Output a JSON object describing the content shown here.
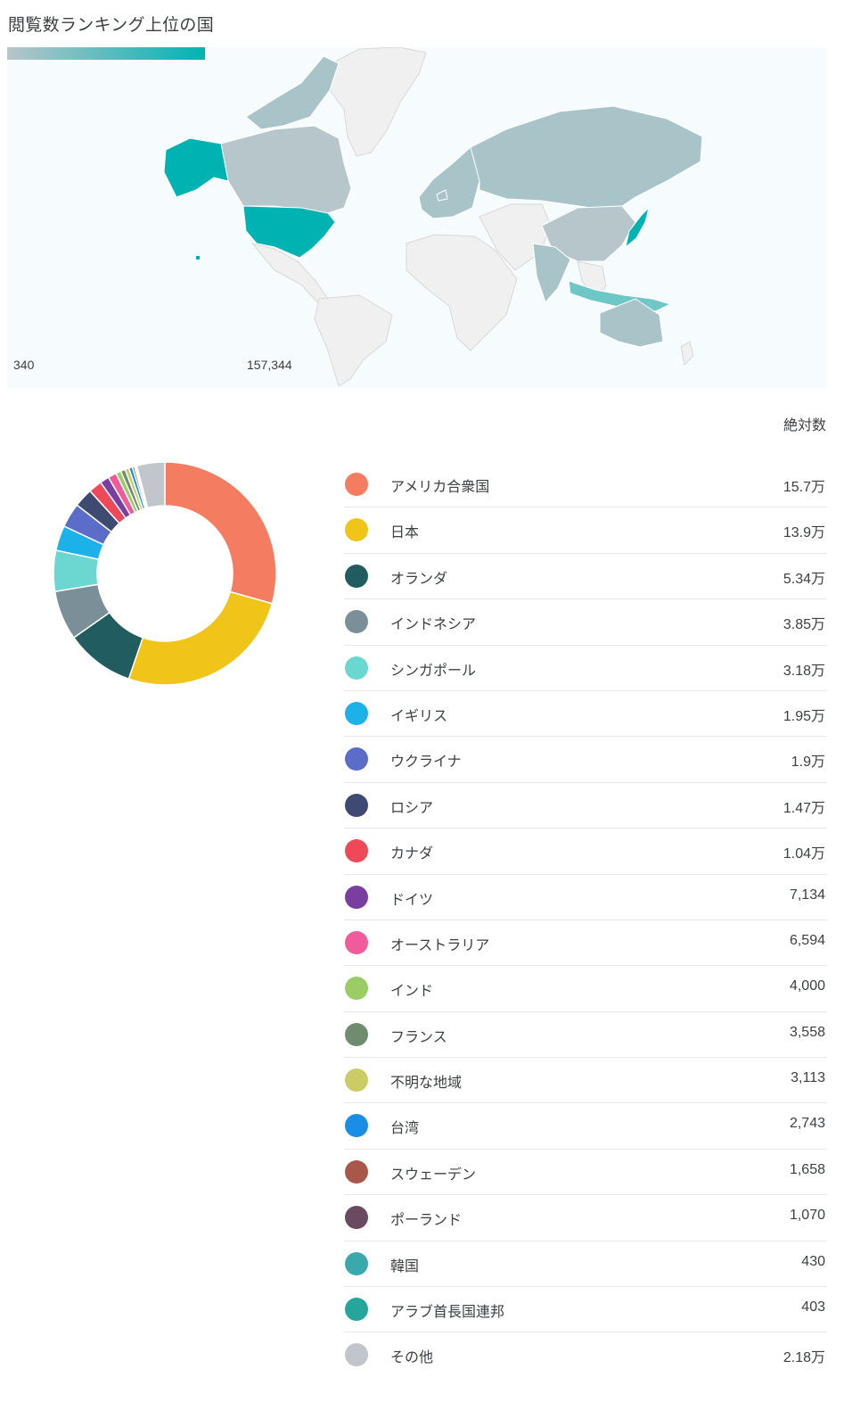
{
  "page": {
    "title": "閲覧数ランキング上位の国"
  },
  "map": {
    "scale_min": "340",
    "scale_max": "157,344",
    "color_low": "#b9c5c9",
    "color_high": "#00b3b3",
    "color_mid": "#a9c4c9",
    "color_nodata": "#f0f0f0",
    "ocean": "#f6fbfe"
  },
  "table": {
    "header": "絶対数"
  },
  "chart_data": {
    "type": "pie",
    "donut": true,
    "unit_label": "絶対数",
    "entries": [
      {
        "name": "アメリカ合衆国",
        "display": "15.7万",
        "value": 157344,
        "color": "#f47c60"
      },
      {
        "name": "日本",
        "display": "13.9万",
        "value": 139000,
        "color": "#f0c419"
      },
      {
        "name": "オランダ",
        "display": "5.34万",
        "value": 53400,
        "color": "#215d60"
      },
      {
        "name": "インドネシア",
        "display": "3.85万",
        "value": 38500,
        "color": "#7a8f98"
      },
      {
        "name": "シンガポール",
        "display": "3.18万",
        "value": 31800,
        "color": "#6cd6d1"
      },
      {
        "name": "イギリス",
        "display": "1.95万",
        "value": 19500,
        "color": "#1cb1e8"
      },
      {
        "name": "ウクライナ",
        "display": "1.9万",
        "value": 19000,
        "color": "#5b6dc9"
      },
      {
        "name": "ロシア",
        "display": "1.47万",
        "value": 14700,
        "color": "#3f4a72"
      },
      {
        "name": "カナダ",
        "display": "1.04万",
        "value": 10400,
        "color": "#ef4858"
      },
      {
        "name": "ドイツ",
        "display": "7,134",
        "value": 7134,
        "color": "#7a3ea0"
      },
      {
        "name": "オーストラリア",
        "display": "6,594",
        "value": 6594,
        "color": "#ef5b9b"
      },
      {
        "name": "インド",
        "display": "4,000",
        "value": 4000,
        "color": "#9ccc65"
      },
      {
        "name": "フランス",
        "display": "3,558",
        "value": 3558,
        "color": "#6f8c6f"
      },
      {
        "name": "不明な地域",
        "display": "3,113",
        "value": 3113,
        "color": "#cccc66"
      },
      {
        "name": "台湾",
        "display": "2,743",
        "value": 2743,
        "color": "#1a8ee6"
      },
      {
        "name": "スウェーデン",
        "display": "1,658",
        "value": 1658,
        "color": "#a9574a"
      },
      {
        "name": "ポーランド",
        "display": "1,070",
        "value": 1070,
        "color": "#6a4a5e"
      },
      {
        "name": "韓国",
        "display": "430",
        "value": 430,
        "color": "#3ba9ac"
      },
      {
        "name": "アラブ首長国連邦",
        "display": "403",
        "value": 403,
        "color": "#26a69a"
      },
      {
        "name": "その他",
        "display": "2.18万",
        "value": 21800,
        "color": "#c0c6cb"
      }
    ]
  }
}
